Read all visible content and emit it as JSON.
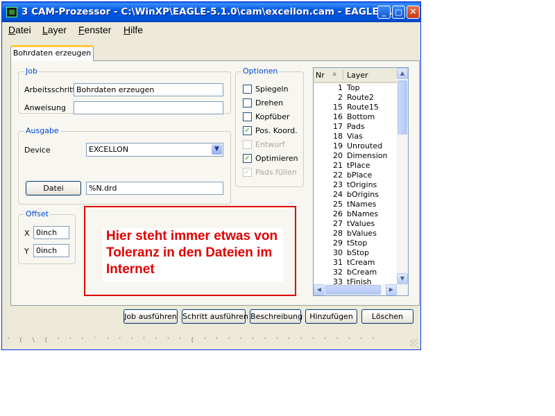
{
  "window": {
    "title": "3 CAM-Prozessor - C:\\WinXP\\EAGLE-5.1.0\\cam\\excellon.cam - EAGLE ...",
    "controls": {
      "minimize": "_",
      "maximize": "□",
      "close": "✕"
    }
  },
  "menu": [
    "Datei",
    "Layer",
    "Fenster",
    "Hilfe"
  ],
  "tab": {
    "label": "Bohrdaten erzeugen"
  },
  "job": {
    "title": "Job",
    "step_label": "Arbeitsschritt",
    "step_value": "Bohrdaten erzeugen",
    "instruction_label": "Anweisung",
    "instruction_value": ""
  },
  "output": {
    "title": "Ausgabe",
    "device_label": "Device",
    "device_value": "EXCELLON",
    "file_button": "Datei",
    "file_value": "%N.drd"
  },
  "offset": {
    "title": "Offset",
    "x_label": "X",
    "x_value": "0inch",
    "y_label": "Y",
    "y_value": "0inch"
  },
  "options": {
    "title": "Optionen",
    "items": [
      {
        "label": "Spiegeln",
        "checked": false,
        "enabled": true
      },
      {
        "label": "Drehen",
        "checked": false,
        "enabled": true
      },
      {
        "label": "Kopfüber",
        "checked": false,
        "enabled": true
      },
      {
        "label": "Pos. Koord.",
        "checked": true,
        "enabled": true
      },
      {
        "label": "Entwurf",
        "checked": false,
        "enabled": false
      },
      {
        "label": "Optimieren",
        "checked": true,
        "enabled": true
      },
      {
        "label": "Pads füllen",
        "checked": true,
        "enabled": false
      }
    ]
  },
  "layers": {
    "header_nr": "Nr",
    "header_layer": "Layer",
    "rows": [
      {
        "nr": "1",
        "name": "Top"
      },
      {
        "nr": "2",
        "name": "Route2"
      },
      {
        "nr": "15",
        "name": "Route15"
      },
      {
        "nr": "16",
        "name": "Bottom"
      },
      {
        "nr": "17",
        "name": "Pads"
      },
      {
        "nr": "18",
        "name": "Vias"
      },
      {
        "nr": "19",
        "name": "Unrouted"
      },
      {
        "nr": "20",
        "name": "Dimension"
      },
      {
        "nr": "21",
        "name": "tPlace"
      },
      {
        "nr": "22",
        "name": "bPlace"
      },
      {
        "nr": "23",
        "name": "tOrigins"
      },
      {
        "nr": "24",
        "name": "bOrigins"
      },
      {
        "nr": "25",
        "name": "tNames"
      },
      {
        "nr": "26",
        "name": "bNames"
      },
      {
        "nr": "27",
        "name": "tValues"
      },
      {
        "nr": "28",
        "name": "bValues"
      },
      {
        "nr": "29",
        "name": "tStop"
      },
      {
        "nr": "30",
        "name": "bStop"
      },
      {
        "nr": "31",
        "name": "tCream"
      },
      {
        "nr": "32",
        "name": "bCream"
      },
      {
        "nr": "33",
        "name": "tFinish"
      }
    ]
  },
  "annotation": {
    "text": "Hier steht immer etwas von Toleranz in den Dateien im Internet",
    "color": "#e00000"
  },
  "buttons": {
    "run_job": "Job ausführen",
    "run_step": "Schritt ausführen",
    "description": "Beschreibung",
    "add": "Hinzufügen",
    "delete": "Löschen"
  },
  "status": {
    "text": "' ( \\ ( ' ' ' ` ' ' ' ' ' ' ' ( ' ' ' ' ' ' ' ' ' ' ' ' ' ' '"
  }
}
